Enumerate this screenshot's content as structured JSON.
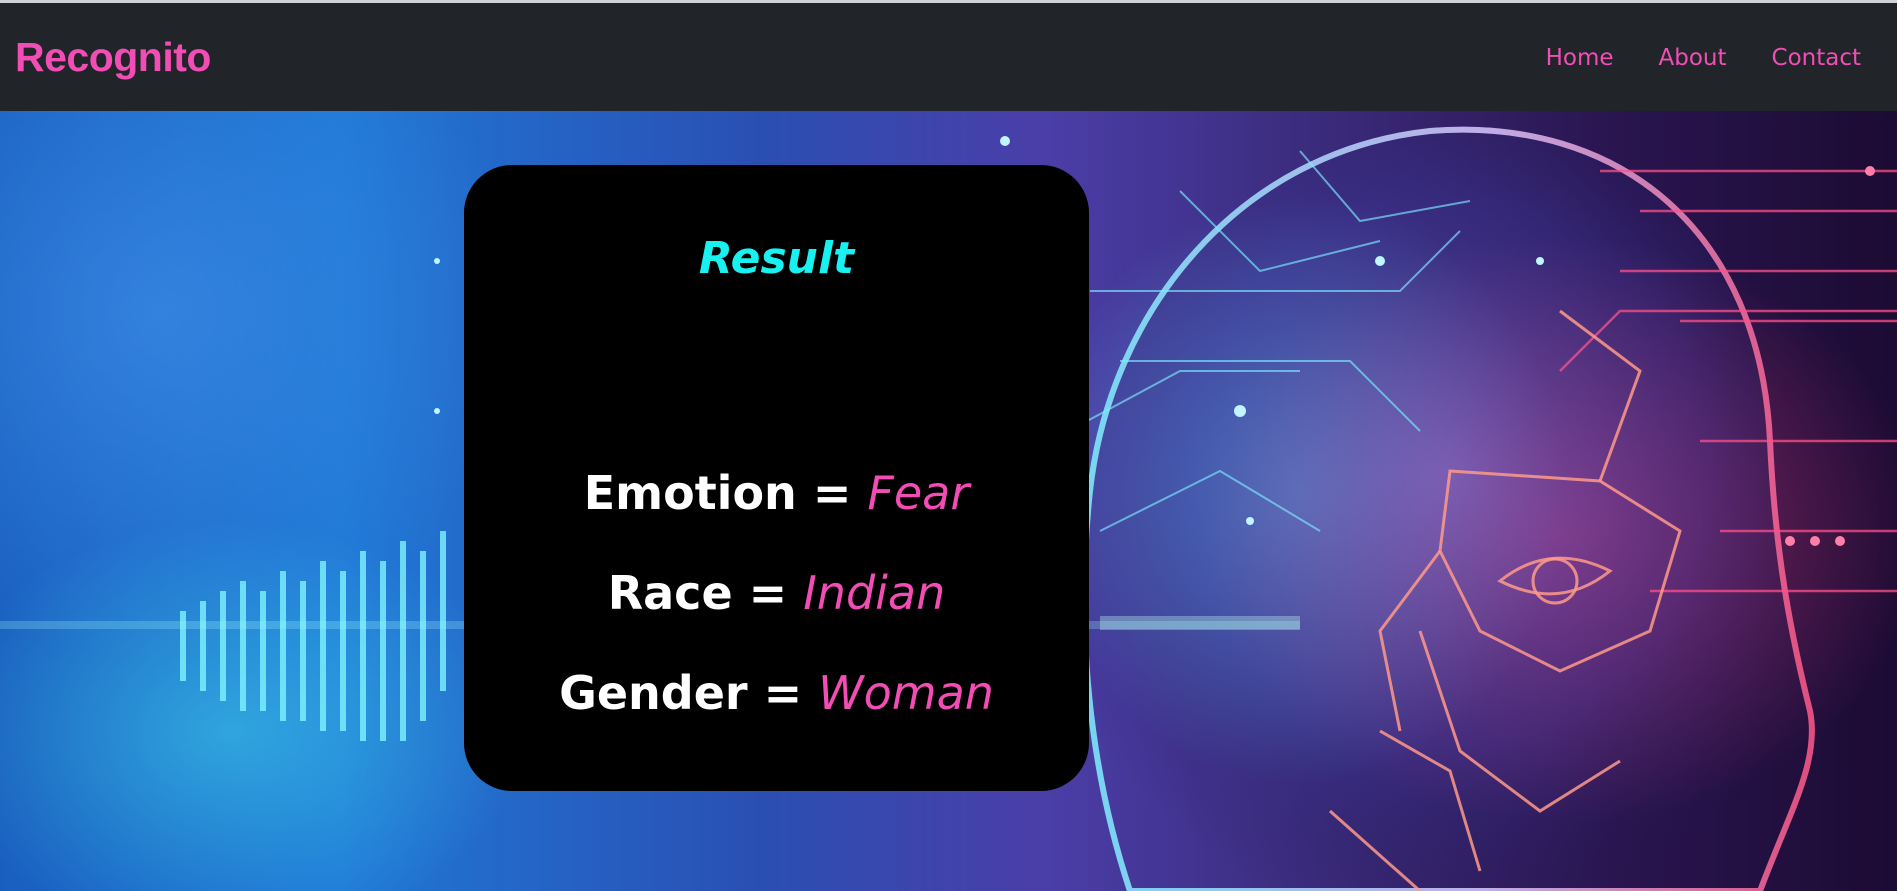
{
  "navbar": {
    "brand": "Recognito",
    "links": [
      {
        "label": "Home"
      },
      {
        "label": "About"
      },
      {
        "label": "Contact"
      }
    ]
  },
  "result": {
    "title": "Result",
    "rows": [
      {
        "label": "Emotion",
        "equals": "=",
        "value": "Fear"
      },
      {
        "label": "Race",
        "equals": "=",
        "value": "Indian"
      },
      {
        "label": "Gender",
        "equals": "=",
        "value": "Woman"
      }
    ]
  },
  "colors": {
    "accent_pink": "#f14db4",
    "accent_cyan": "#19f0f0",
    "navbar_bg": "#212529",
    "card_bg": "#000000"
  },
  "icons": {
    "hero_background": "ai-face-network-illustration"
  }
}
